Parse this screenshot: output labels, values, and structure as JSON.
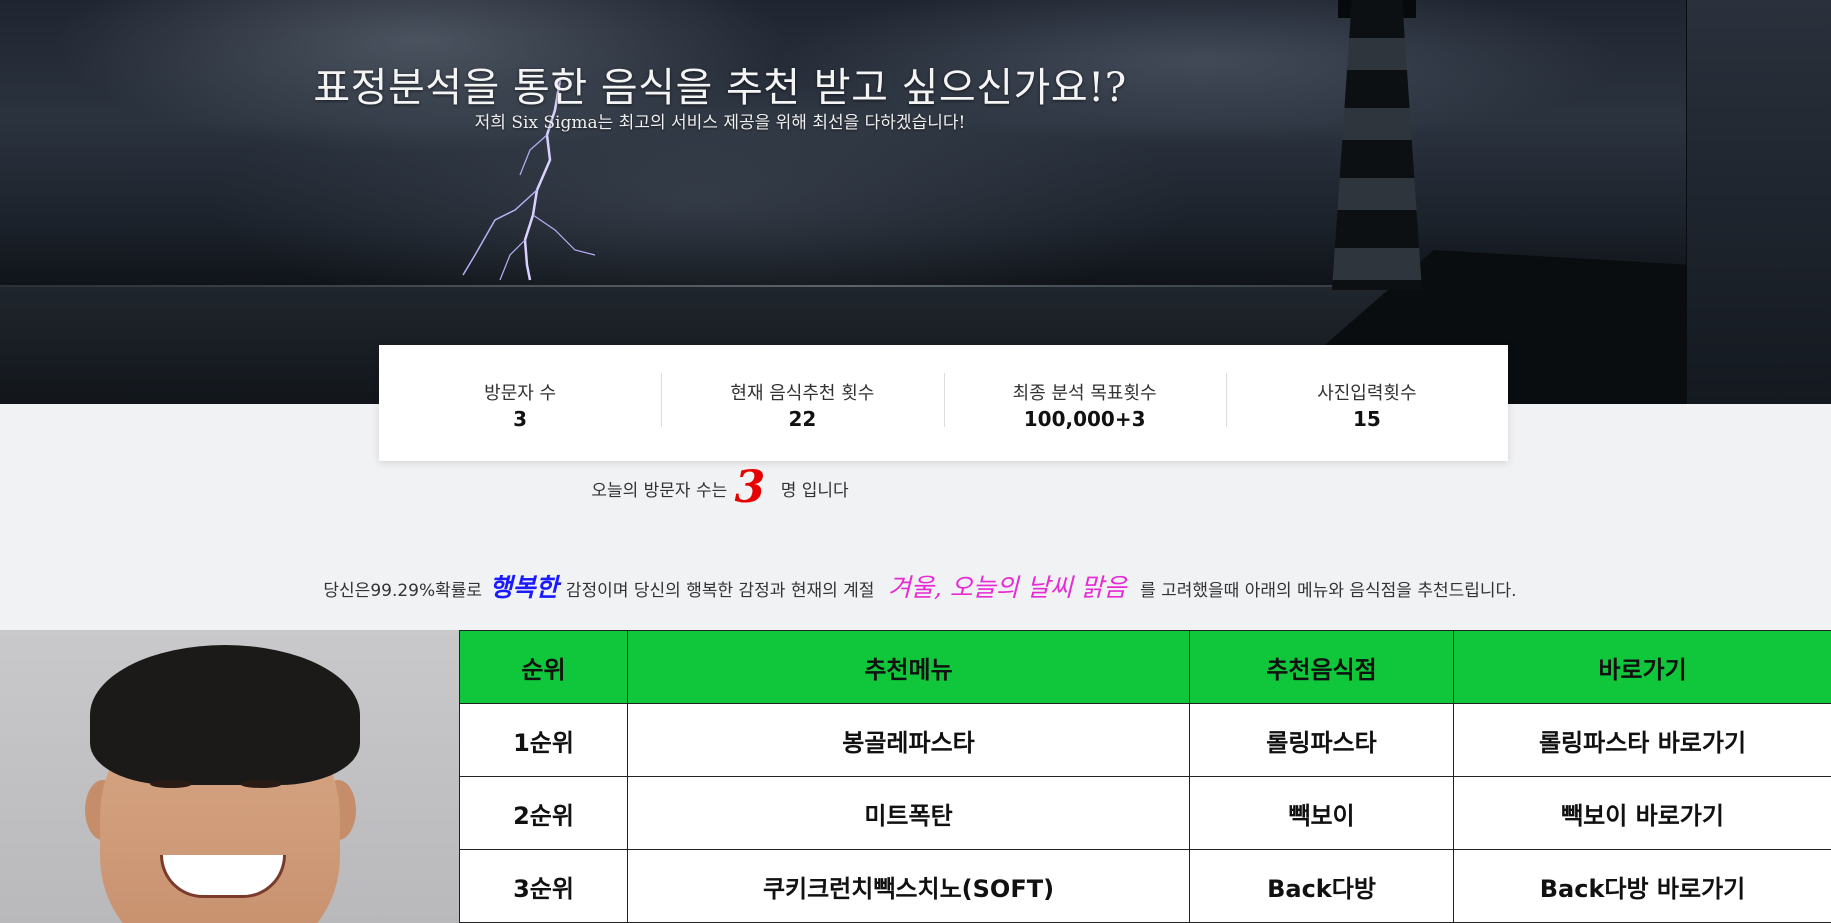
{
  "hero": {
    "title": "표정분석을 통한 음식을 추천 받고 싶으신가요!?",
    "subtitle": "저희 Six Sigma는 최고의 서비스 제공을 위해 최선을 다하겠습니다!"
  },
  "stats": [
    {
      "label": "방문자 수",
      "value": "3"
    },
    {
      "label": "현재 음식추천 횟수",
      "value": "22"
    },
    {
      "label": "최종 분석 목표횟수",
      "value": "100,000+3"
    },
    {
      "label": "사진입력횟수",
      "value": "15"
    }
  ],
  "today": {
    "prefix": "오늘의 방문자 수는",
    "count": "3",
    "suffix": "명 입니다"
  },
  "analysis": {
    "prefix": "당신은99.29%확률로",
    "emotion": "행복한",
    "middle": "감정이며 당신의 행복한 감정과 현재의 계절",
    "season": "겨울, 오늘의 날씨 맑음",
    "suffix": "를 고려했을때 아래의 메뉴와 음식점을 추천드립니다."
  },
  "table": {
    "headers": [
      "순위",
      "추천메뉴",
      "추천음식점",
      "바로가기"
    ],
    "rows": [
      [
        "1순위",
        "봉골레파스타",
        "롤링파스타",
        "롤링파스타 바로가기"
      ],
      [
        "2순위",
        "미트폭탄",
        "빽보이",
        "빽보이 바로가기"
      ],
      [
        "3순위",
        "쿠키크런치빽스치노(SOFT)",
        "Back다방",
        "Back다방 바로가기"
      ]
    ]
  },
  "colors": {
    "header_green": "#10c63a",
    "count_red": "#e60000",
    "emotion_blue": "#1a1aff",
    "season_magenta": "#e62ad6"
  }
}
